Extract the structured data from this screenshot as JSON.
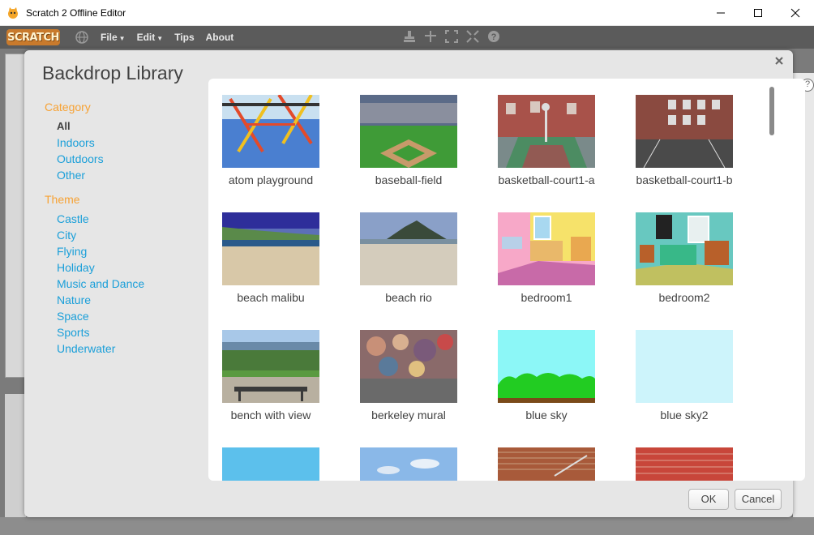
{
  "window": {
    "title": "Scratch 2 Offline Editor"
  },
  "menubar": {
    "logo": "SCRATCH",
    "items": [
      {
        "label": "File",
        "has_arrow": true
      },
      {
        "label": "Edit",
        "has_arrow": true
      },
      {
        "label": "Tips",
        "has_arrow": false
      },
      {
        "label": "About",
        "has_arrow": false
      }
    ],
    "tool_icons": [
      "duplicate-stamp-icon",
      "cut-icon",
      "grow-icon",
      "shrink-icon",
      "help-icon"
    ]
  },
  "dialog": {
    "title": "Backdrop Library",
    "close_icon": "close-x-icon",
    "category": {
      "heading": "Category",
      "items": [
        "All",
        "Indoors",
        "Outdoors",
        "Other"
      ],
      "selected": "All"
    },
    "theme": {
      "heading": "Theme",
      "items": [
        "Castle",
        "City",
        "Flying",
        "Holiday",
        "Music and Dance",
        "Nature",
        "Space",
        "Sports",
        "Underwater"
      ]
    },
    "backdrops": [
      {
        "name": "atom playground"
      },
      {
        "name": "baseball-field"
      },
      {
        "name": "basketball-court1-a"
      },
      {
        "name": "basketball-court1-b"
      },
      {
        "name": "beach malibu"
      },
      {
        "name": "beach rio"
      },
      {
        "name": "bedroom1"
      },
      {
        "name": "bedroom2"
      },
      {
        "name": "bench with view"
      },
      {
        "name": "berkeley mural"
      },
      {
        "name": "blue sky"
      },
      {
        "name": "blue sky2"
      },
      {
        "name": ""
      },
      {
        "name": ""
      },
      {
        "name": ""
      },
      {
        "name": ""
      }
    ],
    "ok_label": "OK",
    "cancel_label": "Cancel"
  },
  "colors": {
    "accent_orange": "#f7a234",
    "link_blue": "#1a9fd9",
    "menubar": "#5b5b5b"
  }
}
